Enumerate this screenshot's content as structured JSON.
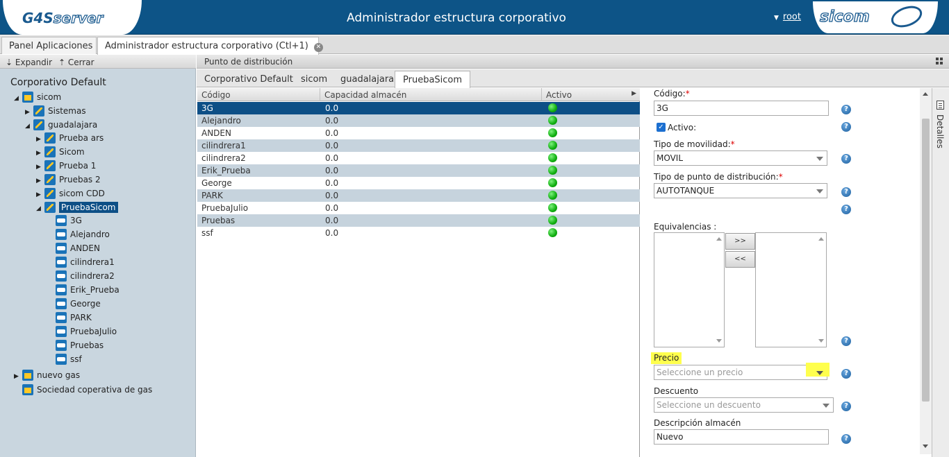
{
  "header": {
    "logo_left": {
      "a": "G4S",
      "b": "server"
    },
    "title": "Administrador estructura corporativo",
    "user": "root",
    "logo_right": "sicom"
  },
  "app_tabs": [
    {
      "label": "Panel Aplicaciones"
    },
    {
      "label": "Administrador estructura corporativo (Ctl+1)"
    }
  ],
  "left_toolbar": {
    "expand": "Expandir",
    "collapse": "Cerrar"
  },
  "tree": {
    "root": "Corporativo Default",
    "sicom": "sicom",
    "sistemas": "Sistemas",
    "guadalajara": "guadalajara",
    "prueba_ars": "Prueba ars",
    "sicom_child": "Sicom",
    "prueba1": "Prueba 1",
    "pruebas2": "Pruebas 2",
    "sicom_cdd": "sicom CDD",
    "pruebasicom": "PruebaSicom",
    "tanks": [
      "3G",
      "Alejandro",
      "ANDEN",
      "cilindrera1",
      "cilindrera2",
      "Erik_Prueba",
      "George",
      "PARK",
      "PruebaJulio",
      "Pruebas",
      "ssf"
    ],
    "nuevo_gas": "nuevo gas",
    "sociedad": "Sociedad coperativa de gas"
  },
  "main": {
    "section_title": "Punto de distribución",
    "tabs": [
      "Corporativo Default",
      "sicom",
      "guadalajara",
      "PruebaSicom"
    ]
  },
  "grid": {
    "columns": [
      "Código",
      "Capacidad almacén",
      "Activo"
    ],
    "rows": [
      {
        "codigo": "3G",
        "capacidad": "0.0"
      },
      {
        "codigo": "Alejandro",
        "capacidad": "0.0"
      },
      {
        "codigo": "ANDEN",
        "capacidad": "0.0"
      },
      {
        "codigo": "cilindrera1",
        "capacidad": "0.0"
      },
      {
        "codigo": "cilindrera2",
        "capacidad": "0.0"
      },
      {
        "codigo": "Erik_Prueba",
        "capacidad": "0.0"
      },
      {
        "codigo": "George",
        "capacidad": "0.0"
      },
      {
        "codigo": "PARK",
        "capacidad": "0.0"
      },
      {
        "codigo": "PruebaJulio",
        "capacidad": "0.0"
      },
      {
        "codigo": "Pruebas",
        "capacidad": "0.0"
      },
      {
        "codigo": "ssf",
        "capacidad": "0.0"
      }
    ],
    "active_color": "#11b011",
    "selected_row_color": "#0d4f86"
  },
  "detail": {
    "codigo_label": "Código:",
    "codigo_value": "3G",
    "activo_label": "Activo:",
    "movilidad_label": "Tipo de movilidad:",
    "movilidad_value": "MOVIL",
    "tipo_pd_label": "Tipo de punto de distribución:",
    "tipo_pd_value": "AUTOTANQUE",
    "equivalencias_label": "Equivalencias :",
    "move_right": ">>",
    "move_left": "<<",
    "precio_label": "Precio",
    "precio_placeholder": "Seleccione un precio",
    "descuento_label": "Descuento",
    "descuento_placeholder": "Seleccione un descuento",
    "desc_almacen_label": "Descripción almacén",
    "desc_almacen_value": "Nuevo",
    "help_glyph": "?",
    "required_mark": "*"
  },
  "side_tab": {
    "label": "Detalles"
  },
  "colors": {
    "header_bg": "#0d5487",
    "highlight": "#ffff4d",
    "tree_bg": "#c9d6df",
    "alt_row": "#c6d3dd"
  }
}
